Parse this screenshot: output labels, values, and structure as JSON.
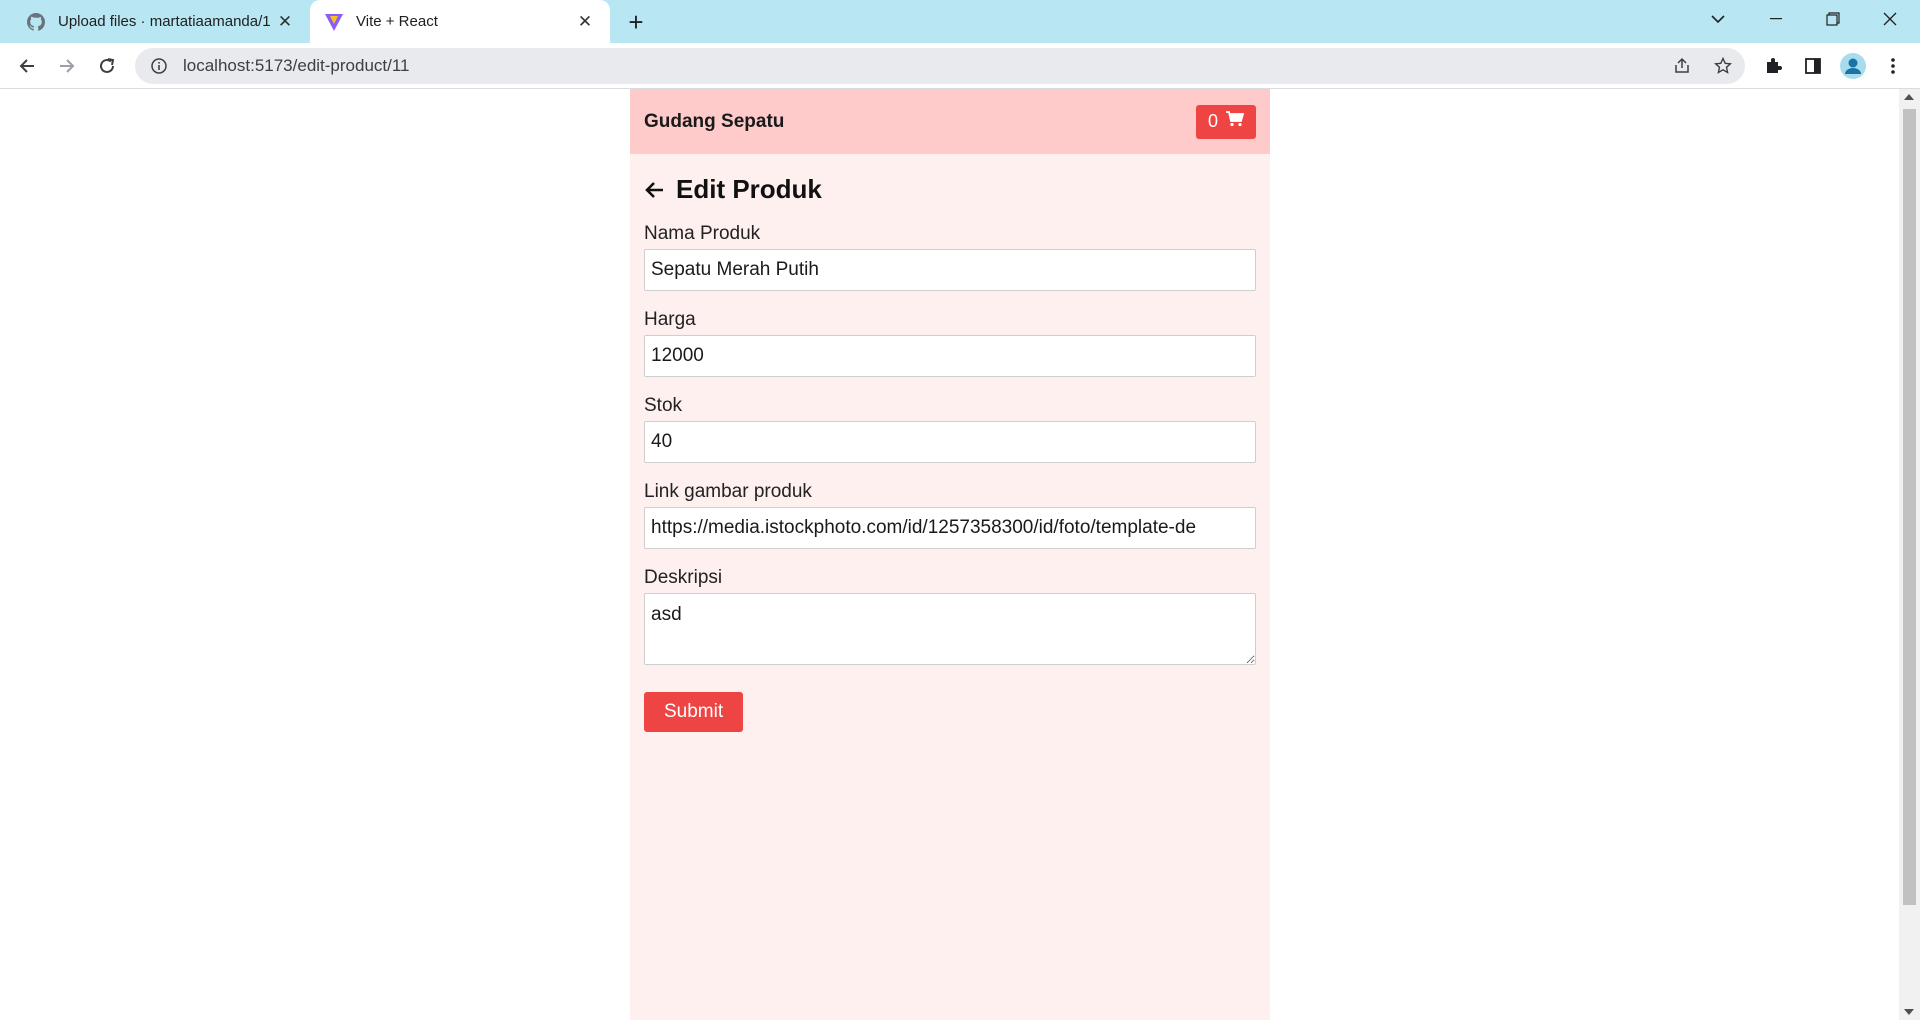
{
  "browser": {
    "tabs": [
      {
        "title": "Upload files · martatiaamanda/1",
        "favicon": "github-icon"
      },
      {
        "title": "Vite + React",
        "favicon": "vite-icon"
      }
    ],
    "url": "localhost:5173/edit-product/11"
  },
  "app": {
    "brand": "Gudang Sepatu",
    "cart_count": "0",
    "page_title": "Edit Produk",
    "fields": {
      "nama": {
        "label": "Nama Produk",
        "value": "Sepatu Merah Putih"
      },
      "harga": {
        "label": "Harga",
        "value": "12000"
      },
      "stok": {
        "label": "Stok",
        "value": "40"
      },
      "gambar": {
        "label": "Link gambar produk",
        "value": "https://media.istockphoto.com/id/1257358300/id/foto/template-de"
      },
      "deskripsi": {
        "label": "Deskripsi",
        "value": "asd"
      }
    },
    "submit_label": "Submit",
    "colors": {
      "accent": "#ef4444",
      "navbar": "#fecaca",
      "page_bg": "#fff0f0"
    }
  }
}
